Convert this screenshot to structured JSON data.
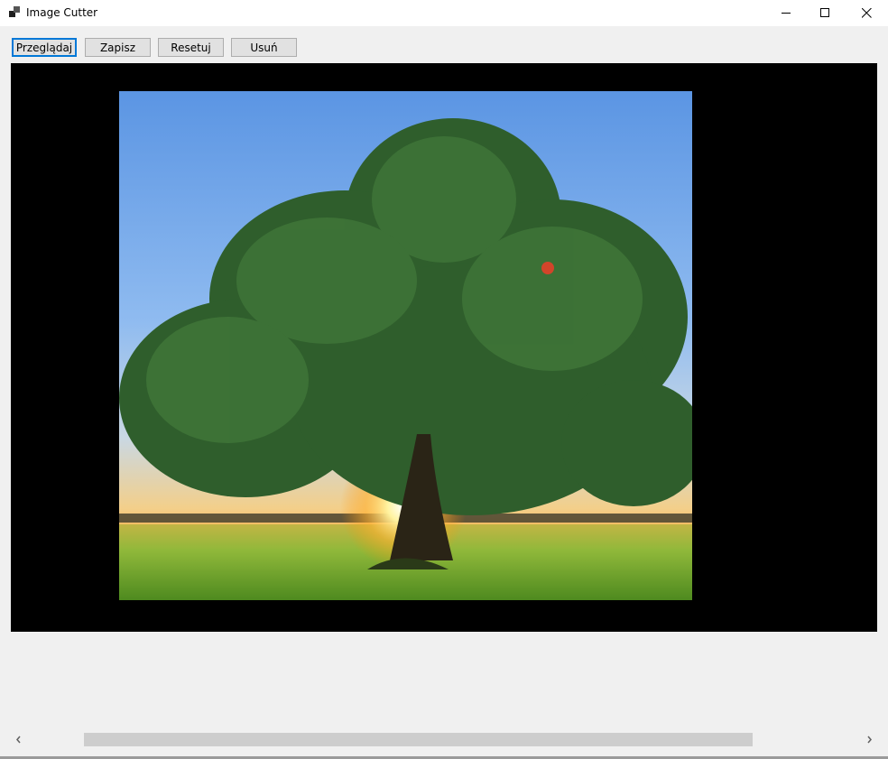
{
  "window": {
    "title": "Image Cutter",
    "icon": "app-window-icon",
    "controls": [
      "minimize-icon",
      "maximize-icon",
      "close-icon"
    ]
  },
  "toolbar": {
    "browse_label": "Przeglądaj",
    "save_label": "Zapisz",
    "reset_label": "Resetuj",
    "delete_label": "Usuń"
  },
  "canvas": {
    "background": "#000000",
    "image": "photo of a large green oak tree in a meadow at sunset"
  },
  "scrollbar": {
    "orientation": "horizontal",
    "left_icon": "chevron-left-icon",
    "right_icon": "chevron-right-icon"
  },
  "colors": {
    "focus_border": "#0078d7",
    "button_face": "#e1e1e1",
    "window_bg": "#f0f0f0"
  }
}
